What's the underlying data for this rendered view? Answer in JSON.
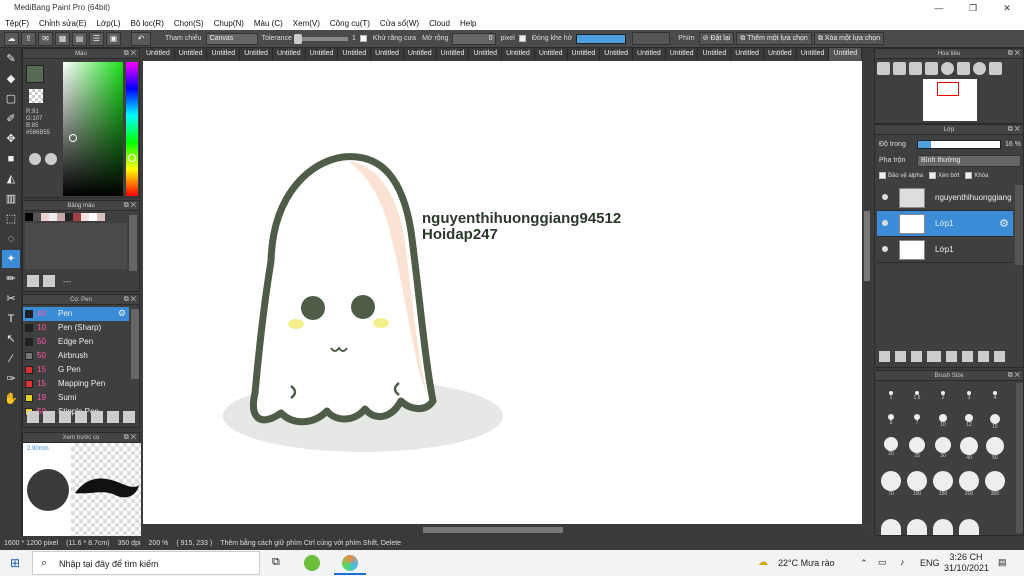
{
  "window": {
    "title": "MediBang Paint Pro (64bit)"
  },
  "menu": [
    "Tệp(F)",
    "Chỉnh sửa(E)",
    "Lớp(L)",
    "Bộ lọc(R)",
    "Chọn(S)",
    "Chụp(N)",
    "Màu (C)",
    "Xem(V)",
    "Công cụ(T)",
    "Cửa sổ(W)",
    "Cloud",
    "Help"
  ],
  "toolbar": {
    "reference_label": "Tham chiếu",
    "reference_value": "Canvas",
    "tolerance_label": "Tolerance",
    "tolerance_value": "1",
    "antialias_label": "Khử răng cưa",
    "expand_label": "Mở rộng",
    "expand_value": "0",
    "expand_unit": "pixel",
    "close_gap_label": "Đóng khe hở",
    "key_label": "Phím",
    "reset_label": "Đặt lại",
    "add_selection_label": "Thêm một lựa chọn",
    "delete_selection_label": "Xóa một lựa chọn"
  },
  "panels": {
    "color": "Màu",
    "palette": "Bảng màu",
    "brush": "Cọ: Pen",
    "preview": "Xem trước cọ",
    "navigator": "Hoa tiêu",
    "layer": "Lớp",
    "brush_size": "Brush Size"
  },
  "color": {
    "r": "R:91",
    "g": "G:107",
    "b": "B:85",
    "hex": "#586B55",
    "current": "#586B55"
  },
  "tabs": [
    "Untitled",
    "Untitled",
    "Untitled",
    "Untitled",
    "Untitled",
    "Untitled",
    "Untitled",
    "Untitled",
    "Untitled",
    "Untitled",
    "Untitled",
    "Untitled",
    "Untitled",
    "Untitled",
    "Untitled",
    "Untitled",
    "Untitled",
    "Untitled",
    "Untitled",
    "Untitled",
    "Untitled",
    "Untitled"
  ],
  "brushes": [
    {
      "size": "40",
      "name": "Pen",
      "color": "#222222"
    },
    {
      "size": "10",
      "name": "Pen (Sharp)",
      "color": "#222222"
    },
    {
      "size": "50",
      "name": "Edge Pen",
      "color": "#222222"
    },
    {
      "size": "50",
      "name": "Airbrush",
      "color": "#777777"
    },
    {
      "size": "15",
      "name": "G Pen",
      "color": "#e03030"
    },
    {
      "size": "15",
      "name": "Mapping Pen",
      "color": "#e03030"
    },
    {
      "size": "19",
      "name": "Sumi",
      "color": "#e8d020"
    },
    {
      "size": "50",
      "name": "Stipple Pen",
      "color": "#e8d020"
    }
  ],
  "preview": {
    "size": "2.90mm"
  },
  "layer": {
    "opacity_label": "Độ trong",
    "opacity_value": "16 %",
    "opacity_fraction": 0.16,
    "blend_label": "Pha trộn",
    "blend_value": "Bình thường",
    "protect_alpha": "Bảo vệ alpha",
    "clipping": "Xén bớt",
    "lock": "Khóa",
    "layers": [
      {
        "name": "nguyenthihuonggiang",
        "selected": false
      },
      {
        "name": "Lớp1",
        "selected": true
      },
      {
        "name": "Lớp1",
        "selected": false
      }
    ]
  },
  "canvas_text": [
    "nguyenthihuonggiang94512",
    "Hoidap247"
  ],
  "brush_sizes": [
    "1",
    "1.5",
    "2",
    "3",
    "4",
    "5",
    "7",
    "10",
    "12",
    "15",
    "20",
    "25",
    "30",
    "40",
    "50",
    "70",
    "100",
    "150",
    "200",
    "300"
  ],
  "status": {
    "size": "1600 * 1200 pixel",
    "cm": "(11.6 * 8.7cm)",
    "dpi": "350 dpi",
    "zoom": "200 %",
    "coords": "( 915, 233 )",
    "hint": "Thêm bằng cách giữ phím Ctrl cùng với phím Shift, Delete"
  },
  "taskbar": {
    "search": "Nhập tại đây để tìm kiếm",
    "weather": "22°C  Mưa rào",
    "lang": "ENG",
    "time": "3:26 CH",
    "date": "31/10/2021"
  }
}
